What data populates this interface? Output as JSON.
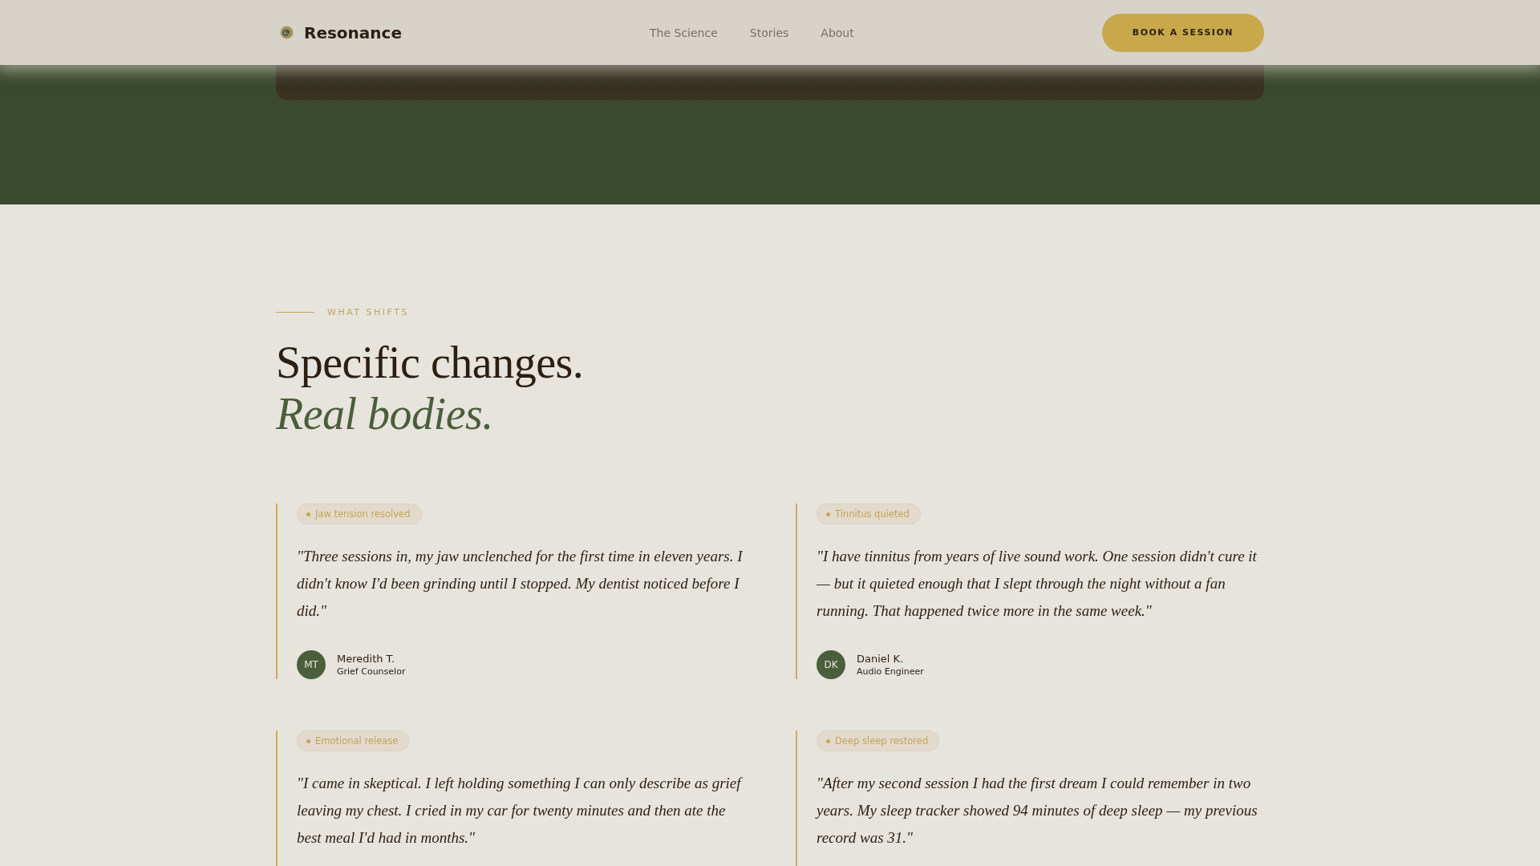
{
  "header": {
    "brand": "Resonance",
    "nav": [
      {
        "label": "The Science"
      },
      {
        "label": "Stories"
      },
      {
        "label": "About"
      }
    ],
    "cta": "BOOK A SESSION"
  },
  "section": {
    "eyebrow": "WHAT SHIFTS",
    "title": "Specific changes.",
    "title_accent": "Real bodies.",
    "testimonials": [
      {
        "tag": "Jaw tension resolved",
        "quote": "\"Three sessions in, my jaw unclenched for the first time in eleven years. I didn't know I'd been grinding until I stopped. My dentist noticed before I did.\"",
        "author": {
          "initials": "MT",
          "name": "Meredith T.",
          "role": "Grief Counselor"
        }
      },
      {
        "tag": "Tinnitus quieted",
        "quote": "\"I have tinnitus from years of live sound work. One session didn't cure it — but it quieted enough that I slept through the night without a fan running. That happened twice more in the same week.\"",
        "author": {
          "initials": "DK",
          "name": "Daniel K.",
          "role": "Audio Engineer"
        }
      },
      {
        "tag": "Emotional release",
        "quote": "\"I came in skeptical. I left holding something I can only describe as grief leaving my chest. I cried in my car for twenty minutes and then ate the best meal I'd had in months.\""
      },
      {
        "tag": "Deep sleep restored",
        "quote": "\"After my second session I had the first dream I could remember in two years. My sleep tracker showed 94 minutes of deep sleep — my previous record was 31.\""
      }
    ]
  }
}
